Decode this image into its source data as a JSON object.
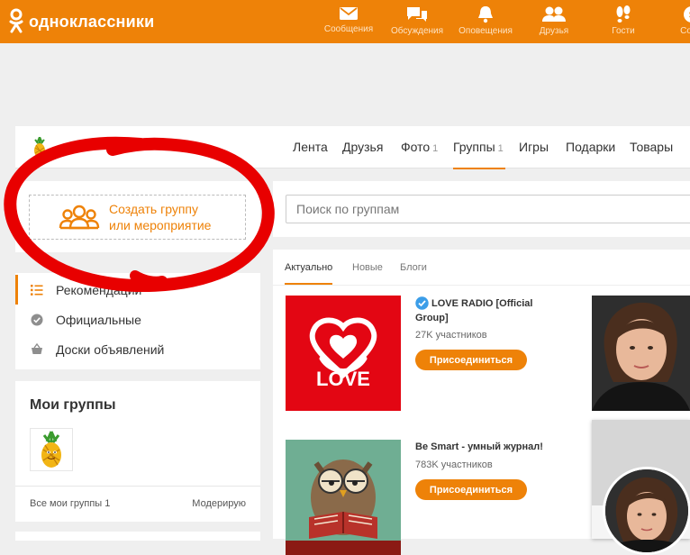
{
  "brand": {
    "name": "одноклассники",
    "accent": "#ee8208"
  },
  "topnav": [
    {
      "id": "messages",
      "label": "Сообщения",
      "icon": "envelope-icon"
    },
    {
      "id": "discussions",
      "label": "Обсуждения",
      "icon": "chat-bubbles-icon"
    },
    {
      "id": "notifications",
      "label": "Оповещения",
      "icon": "bell-icon"
    },
    {
      "id": "friends",
      "label": "Друзья",
      "icon": "people-icon"
    },
    {
      "id": "guests",
      "label": "Гости",
      "icon": "footprints-icon"
    },
    {
      "id": "events",
      "label": "Собы",
      "icon": "coin-icon"
    }
  ],
  "profile_nav": {
    "items": [
      {
        "label": "Лента",
        "count": ""
      },
      {
        "label": "Друзья",
        "count": ""
      },
      {
        "label": "Фото",
        "count": "1"
      },
      {
        "label": "Группы",
        "count": "1",
        "active": true
      },
      {
        "label": "Игры",
        "count": ""
      },
      {
        "label": "Подарки",
        "count": ""
      },
      {
        "label": "Товары",
        "count": ""
      }
    ]
  },
  "create_group": {
    "line1": "Создать группу",
    "line2": "или мероприятие"
  },
  "side_menu": {
    "items": [
      {
        "label": "Рекомендации",
        "icon": "list-icon",
        "selected": true
      },
      {
        "label": "Официальные",
        "icon": "check-badge-icon"
      },
      {
        "label": "Доски объявлений",
        "icon": "basket-icon"
      }
    ]
  },
  "my_groups": {
    "title": "Мои группы",
    "all_label": "Все мои группы 1",
    "moderate_label": "Модерирую"
  },
  "search": {
    "placeholder": "Поиск по группам"
  },
  "tabs": [
    {
      "label": "Актуально",
      "active": true
    },
    {
      "label": "Новые"
    },
    {
      "label": "Блоги"
    }
  ],
  "groups": [
    {
      "title": "LOVE RADIO [Official Group]",
      "members": "27K участников",
      "join_label": "Присоединиться",
      "verified": true,
      "logo_text": "LOVE"
    },
    {
      "title": "Be Smart - умный журнал!",
      "members": "783K участников",
      "join_label": "Присоединиться",
      "verified": false
    }
  ]
}
